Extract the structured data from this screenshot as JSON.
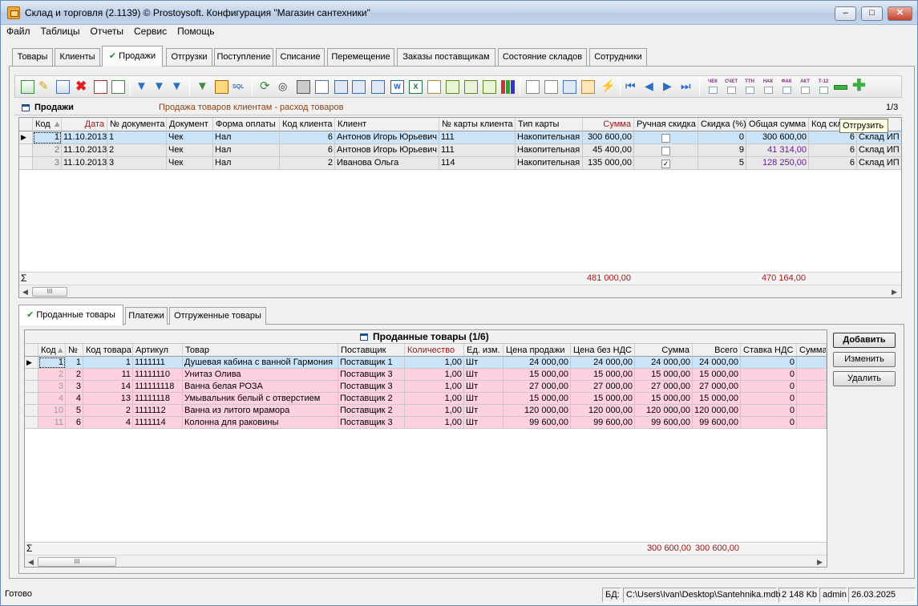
{
  "window": {
    "title": "Склад и торговля (2.1139) © Prostoysoft. Конфигурация \"Магазин сантехники\""
  },
  "menu": [
    "Файл",
    "Таблицы",
    "Отчеты",
    "Сервис",
    "Помощь"
  ],
  "tabs": [
    "Товары",
    "Клиенты",
    "Продажи",
    "Отгрузки",
    "Поступление",
    "Списание",
    "Перемещение",
    "Заказы поставщикам",
    "Состояние складов",
    "Сотрудники"
  ],
  "active_tab": "Продажи",
  "toolbar_text_buttons": [
    "ЧЕК",
    "СЧЕТ",
    "ТТН",
    "НАК",
    "ФАК",
    "АКТ",
    "Т-12"
  ],
  "sales": {
    "title": "Продажи",
    "subtitle": "Продажа товаров клиентам - расход товаров",
    "counter": "1/3",
    "columns": [
      "Код",
      "Дата",
      "№ документа",
      "Документ",
      "Форма оплаты",
      "Код клиента",
      "Клиент",
      "№ карты клиента",
      "Тип карты",
      "Сумма",
      "Ручная скидка",
      "Скидка (%)",
      "Общая сумма",
      "Код скл",
      ""
    ],
    "rows": [
      {
        "kod": "1",
        "date": "11.10.2013",
        "doc_no": "1",
        "doc": "Чек",
        "payment": "Нал",
        "client_code": "6",
        "client": "Антонов Игорь Юрьевич",
        "card_no": "111",
        "card_type": "Накопительная",
        "sum": "300 600,00",
        "manual": false,
        "discount": "0",
        "total": "300 600,00",
        "wh_code": "6",
        "wh": "Склад ИП"
      },
      {
        "kod": "2",
        "date": "11.10.2013",
        "doc_no": "2",
        "doc": "Чек",
        "payment": "Нал",
        "client_code": "6",
        "client": "Антонов Игорь Юрьевич",
        "card_no": "111",
        "card_type": "Накопительная",
        "sum": "45 400,00",
        "manual": false,
        "discount": "9",
        "total": "41 314,00",
        "wh_code": "6",
        "wh": "Склад ИП"
      },
      {
        "kod": "3",
        "date": "11.10.2013",
        "doc_no": "3",
        "doc": "Чек",
        "payment": "Нал",
        "client_code": "2",
        "client": "Иванова Ольга",
        "card_no": "114",
        "card_type": "Накопительная",
        "sum": "135 000,00",
        "manual": true,
        "discount": "5",
        "total": "128 250,00",
        "wh_code": "6",
        "wh": "Склад ИП"
      }
    ],
    "sum_symbol": "Σ",
    "totals": {
      "sum": "481 000,00",
      "total": "470 164,00"
    },
    "tooltip": "Отгрузить"
  },
  "subtabs": [
    "Проданные товары",
    "Платежи",
    "Отгруженные товары"
  ],
  "sold": {
    "title": "Проданные товары (1/6)",
    "columns": [
      "Код",
      "№",
      "Код товара",
      "Артикул",
      "Товар",
      "Поставщик",
      "Количество",
      "Ед. изм.",
      "Цена продажи",
      "Цена без НДС",
      "Сумма",
      "Всего",
      "Ставка НДС",
      "Сумма"
    ],
    "rows": [
      {
        "kod": "1",
        "no": "1",
        "code": "1",
        "art": "1111111",
        "name": "Душевая кабина с ванной Гармония",
        "supplier": "Поставщик 1",
        "qty": "1,00",
        "unit": "Шт",
        "price": "24 000,00",
        "price_nds": "24 000,00",
        "sum": "24 000,00",
        "total": "24 000,00",
        "vat": "0"
      },
      {
        "kod": "2",
        "no": "2",
        "code": "11",
        "art": "11111110",
        "name": "Унитаз Олива",
        "supplier": "Поставщик 3",
        "qty": "1,00",
        "unit": "Шт",
        "price": "15 000,00",
        "price_nds": "15 000,00",
        "sum": "15 000,00",
        "total": "15 000,00",
        "vat": "0"
      },
      {
        "kod": "3",
        "no": "3",
        "code": "14",
        "art": "111111118",
        "name": "Ванна белая РОЗА",
        "supplier": "Поставщик 3",
        "qty": "1,00",
        "unit": "Шт",
        "price": "27 000,00",
        "price_nds": "27 000,00",
        "sum": "27 000,00",
        "total": "27 000,00",
        "vat": "0"
      },
      {
        "kod": "4",
        "no": "4",
        "code": "13",
        "art": "11111118",
        "name": "Умывальник белый с отверстием",
        "supplier": "Поставщик 2",
        "qty": "1,00",
        "unit": "Шт",
        "price": "15 000,00",
        "price_nds": "15 000,00",
        "sum": "15 000,00",
        "total": "15 000,00",
        "vat": "0"
      },
      {
        "kod": "10",
        "no": "5",
        "code": "2",
        "art": "1111112",
        "name": "Ванна из литого мрамора",
        "supplier": "Поставщик 2",
        "qty": "1,00",
        "unit": "Шт",
        "price": "120 000,00",
        "price_nds": "120 000,00",
        "sum": "120 000,00",
        "total": "120 000,00",
        "vat": "0"
      },
      {
        "kod": "11",
        "no": "6",
        "code": "4",
        "art": "1111114",
        "name": "Колонна  для раковины",
        "supplier": "Поставщик 3",
        "qty": "1,00",
        "unit": "Шт",
        "price": "99 600,00",
        "price_nds": "99 600,00",
        "sum": "99 600,00",
        "total": "99 600,00",
        "vat": "0"
      }
    ],
    "totals": {
      "sum": "300 600,00",
      "total": "300 600,00"
    },
    "buttons": [
      "Добавить",
      "Изменить",
      "Удалить"
    ]
  },
  "status": {
    "ready": "Готово",
    "db_label": "БД:",
    "db_path": "C:\\Users\\Ivan\\Desktop\\Santehnika.mdb",
    "size": "2 148 Kb",
    "user": "admin",
    "date": "26.03.2025"
  },
  "colors": {
    "selected_row": "#cce4f7",
    "sold_row": "#ffd0e0",
    "red_header": "#a01818",
    "purple_value": "#6a1b9a",
    "hint": "#8b4513"
  }
}
